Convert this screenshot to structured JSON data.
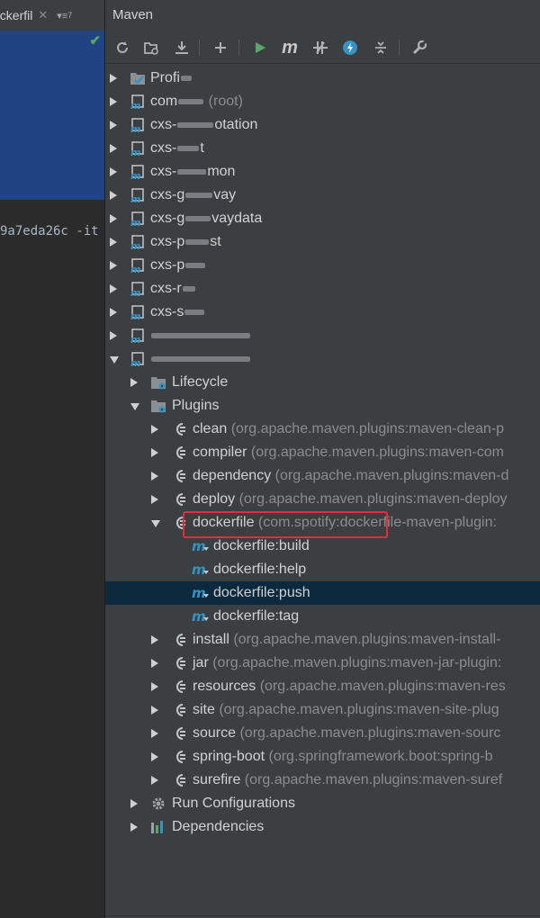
{
  "left": {
    "tab_label": "ockerfil",
    "tab_close": "✕",
    "tab_menu": "▾≡",
    "tab_count": "7",
    "code_line": "9a7eda26c -it"
  },
  "panel_title": "Maven",
  "toolbar_icons": [
    "refresh-icon",
    "reimport-icon",
    "download-icon",
    "add-icon",
    "run-icon",
    "maven-goal-icon",
    "toggle-offline-icon",
    "skip-tests-icon",
    "collapse-all-icon",
    "settings-icon"
  ],
  "tree": {
    "profiles": "Profi",
    "projects": [
      {
        "name": "com",
        "suffix": "(root)"
      },
      {
        "name": "cxs-",
        "tail": "otation"
      },
      {
        "name": "cxs-",
        "tail": "t"
      },
      {
        "name": "cxs-",
        "tail": "mon"
      },
      {
        "name": "cxs-g",
        "tail": "vay"
      },
      {
        "name": "cxs-g",
        "tail": "vaydata"
      },
      {
        "name": "cxs-p",
        "tail": "st"
      },
      {
        "name": "cxs-p",
        "tail": ""
      },
      {
        "name": "cxs-r",
        "tail": ""
      },
      {
        "name": "cxs-s",
        "tail": ""
      }
    ],
    "lifecycle": "Lifecycle",
    "plugins": "Plugins",
    "plugin_items": [
      {
        "name": "clean",
        "coords": "(org.apache.maven.plugins:maven-clean-p"
      },
      {
        "name": "compiler",
        "coords": "(org.apache.maven.plugins:maven-com"
      },
      {
        "name": "dependency",
        "coords": "(org.apache.maven.plugins:maven-d"
      },
      {
        "name": "deploy",
        "coords": "(org.apache.maven.plugins:maven-deploy"
      },
      {
        "name": "dockerfile",
        "coords": "(com.spotify:dockerfile-maven-plugin:"
      }
    ],
    "dockerfile_goals": [
      "dockerfile:build",
      "dockerfile:help",
      "dockerfile:push",
      "dockerfile:tag"
    ],
    "plugin_items_after": [
      {
        "name": "install",
        "coords": "(org.apache.maven.plugins:maven-install-"
      },
      {
        "name": "jar",
        "coords": "(org.apache.maven.plugins:maven-jar-plugin:"
      },
      {
        "name": "resources",
        "coords": "(org.apache.maven.plugins:maven-res"
      },
      {
        "name": "site",
        "coords": "(org.apache.maven.plugins:maven-site-plug"
      },
      {
        "name": "source",
        "coords": "(org.apache.maven.plugins:maven-sourc"
      },
      {
        "name": "spring-boot",
        "coords": "(org.springframework.boot:spring-b"
      },
      {
        "name": "surefire",
        "coords": "(org.apache.maven.plugins:maven-suref"
      }
    ],
    "run_configurations": "Run Configurations",
    "dependencies": "Dependencies"
  },
  "colors": {
    "selection": "#214283",
    "row_selected": "#0d293e",
    "highlight_box": "#e02f3b",
    "run_green": "#59a869",
    "maven_blue": "#3592c4"
  }
}
